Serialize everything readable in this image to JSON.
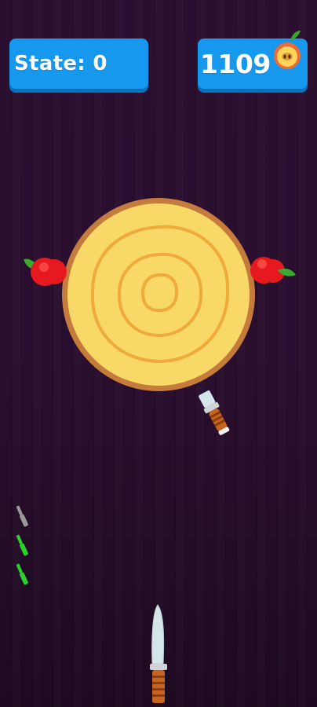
{
  "hud": {
    "state_label": "State:",
    "state_value": "0",
    "score_value": "1109",
    "score_icon": "apple-half-icon"
  },
  "game": {
    "target": "wooden-log-target",
    "apples_on_target": 2,
    "knives_on_target": 1,
    "remaining_knives_icons": 3,
    "active_knife": "knife-ready"
  },
  "colors": {
    "background": "#2a0e2f",
    "hud_blue": "#1598ee",
    "hud_blue_shadow": "#0e6fb6",
    "log_fill": "#f8d866",
    "log_rings": "#f0a93b",
    "log_rim": "#c47b3c",
    "apple_red": "#e5191e",
    "leaf_green": "#3ba82f",
    "knife_handle": "#c9641d",
    "knife_blade": "#d5e6ea",
    "knife_count_green": "#2bd12b",
    "knife_count_grey": "#9a9a9a"
  }
}
